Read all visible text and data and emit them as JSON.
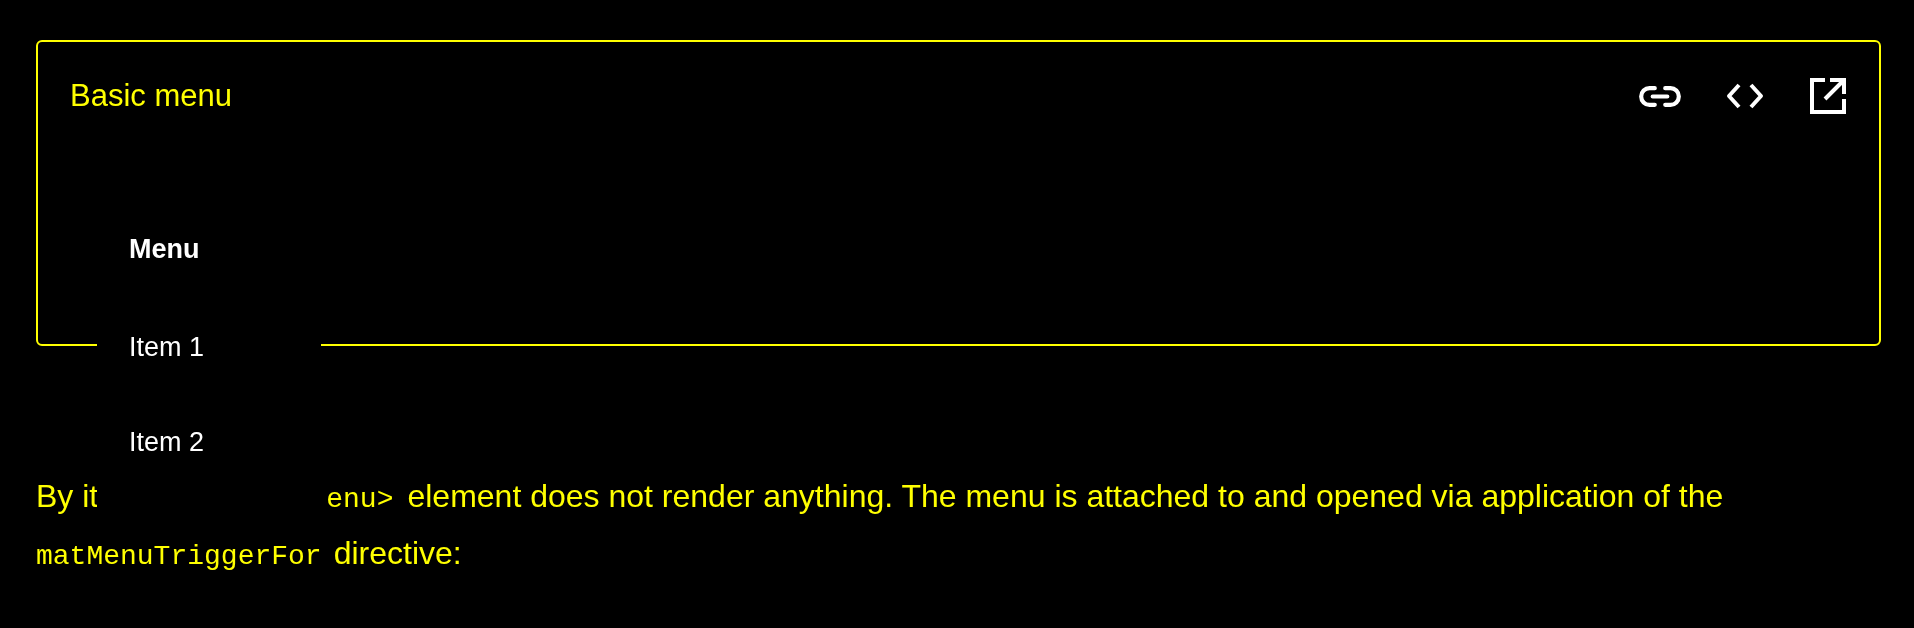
{
  "example": {
    "title": "Basic menu",
    "actions": [
      {
        "kind": "link"
      },
      {
        "kind": "code"
      },
      {
        "kind": "open"
      }
    ],
    "trigger": {
      "label": "Menu"
    }
  },
  "menu": {
    "items": [
      {
        "label": "Item 1"
      },
      {
        "label": "Item 2"
      }
    ]
  },
  "description": {
    "line_1": [
      {
        "kind": "text",
        "text": "By it"
      },
      {
        "kind": "code",
        "text": "enu>"
      },
      {
        "kind": "text",
        "text": "element does not render anything. The menu is attached to and opened via application of the"
      }
    ],
    "line_2": [
      {
        "kind": "code",
        "text": "matMenuTriggerFor"
      },
      {
        "kind": "text",
        "text": "directive:"
      }
    ]
  }
}
